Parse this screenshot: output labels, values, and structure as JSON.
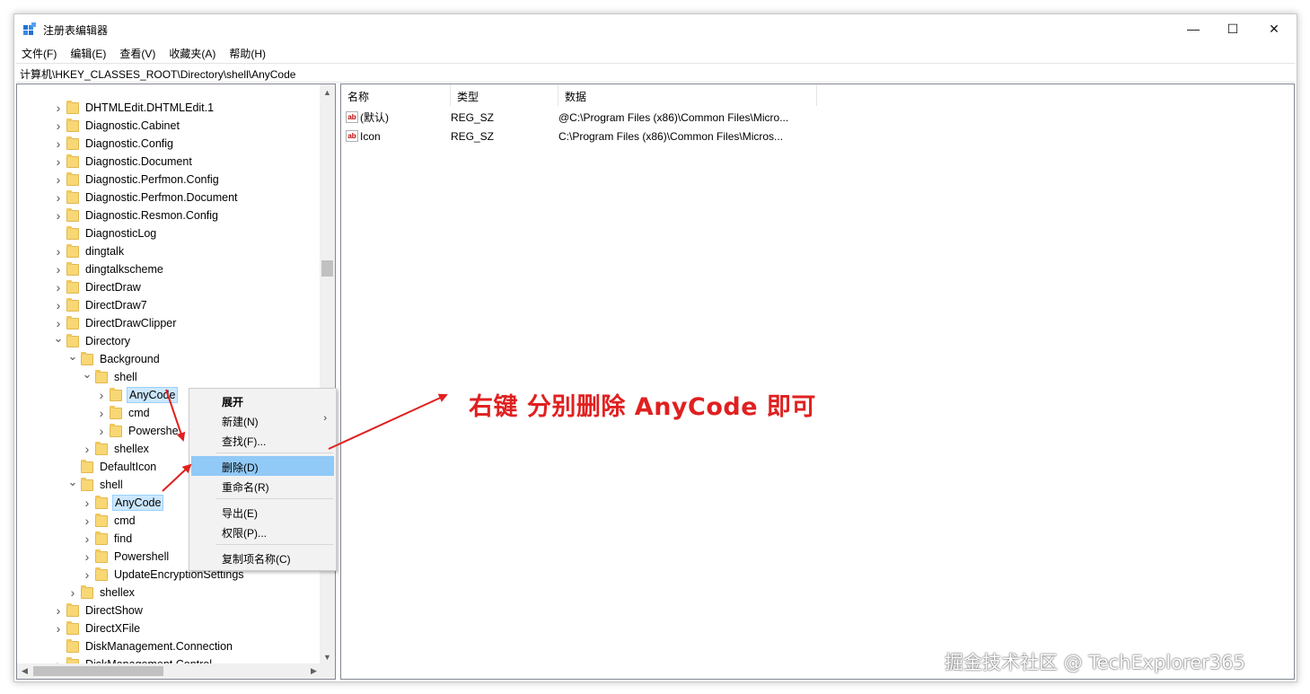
{
  "window": {
    "title": "注册表编辑器",
    "minimize": "—",
    "maximize": "☐",
    "close": "✕"
  },
  "menu": [
    "文件(F)",
    "编辑(E)",
    "查看(V)",
    "收藏夹(A)",
    "帮助(H)"
  ],
  "address": "计算机\\HKEY_CLASSES_ROOT\\Directory\\shell\\AnyCode",
  "tree": {
    "rows": [
      {
        "label": "DHTMLEdit.DHTMLEdit.1",
        "level": 0,
        "exp": "collapsed"
      },
      {
        "label": "Diagnostic.Cabinet",
        "level": 0,
        "exp": "collapsed"
      },
      {
        "label": "Diagnostic.Config",
        "level": 0,
        "exp": "collapsed"
      },
      {
        "label": "Diagnostic.Document",
        "level": 0,
        "exp": "collapsed"
      },
      {
        "label": "Diagnostic.Perfmon.Config",
        "level": 0,
        "exp": "collapsed"
      },
      {
        "label": "Diagnostic.Perfmon.Document",
        "level": 0,
        "exp": "collapsed"
      },
      {
        "label": "Diagnostic.Resmon.Config",
        "level": 0,
        "exp": "collapsed"
      },
      {
        "label": "DiagnosticLog",
        "level": 0,
        "exp": "none"
      },
      {
        "label": "dingtalk",
        "level": 0,
        "exp": "collapsed"
      },
      {
        "label": "dingtalkscheme",
        "level": 0,
        "exp": "collapsed"
      },
      {
        "label": "DirectDraw",
        "level": 0,
        "exp": "collapsed"
      },
      {
        "label": "DirectDraw7",
        "level": 0,
        "exp": "collapsed"
      },
      {
        "label": "DirectDrawClipper",
        "level": 0,
        "exp": "collapsed"
      },
      {
        "label": "Directory",
        "level": 0,
        "exp": "expanded"
      },
      {
        "label": "Background",
        "level": 1,
        "exp": "expanded"
      },
      {
        "label": "shell",
        "level": 2,
        "exp": "expanded"
      },
      {
        "label": "AnyCode",
        "level": 3,
        "exp": "collapsed",
        "selected": true
      },
      {
        "label": "cmd",
        "level": 3,
        "exp": "collapsed"
      },
      {
        "label": "Powershe",
        "level": 3,
        "exp": "collapsed"
      },
      {
        "label": "shellex",
        "level": 2,
        "exp": "collapsed"
      },
      {
        "label": "DefaultIcon",
        "level": 1,
        "exp": "none"
      },
      {
        "label": "shell",
        "level": 1,
        "exp": "expanded"
      },
      {
        "label": "AnyCode",
        "level": 2,
        "exp": "collapsed",
        "selected": true
      },
      {
        "label": "cmd",
        "level": 2,
        "exp": "collapsed"
      },
      {
        "label": "find",
        "level": 2,
        "exp": "collapsed"
      },
      {
        "label": "Powershell",
        "level": 2,
        "exp": "collapsed"
      },
      {
        "label": "UpdateEncryptionSettings",
        "level": 2,
        "exp": "collapsed"
      },
      {
        "label": "shellex",
        "level": 1,
        "exp": "collapsed"
      },
      {
        "label": "DirectShow",
        "level": 0,
        "exp": "collapsed"
      },
      {
        "label": "DirectXFile",
        "level": 0,
        "exp": "collapsed"
      },
      {
        "label": "DiskManagement.Connection",
        "level": 0,
        "exp": "none"
      },
      {
        "label": "DiskManagement.Control",
        "level": 0,
        "exp": "collapsed"
      }
    ]
  },
  "list": {
    "columns": [
      "名称",
      "类型",
      "数据"
    ],
    "rows": [
      {
        "name": "(默认)",
        "type": "REG_SZ",
        "data": "@C:\\Program Files (x86)\\Common Files\\Micro..."
      },
      {
        "name": "Icon",
        "type": "REG_SZ",
        "data": "C:\\Program Files (x86)\\Common Files\\Micros..."
      }
    ],
    "icon_text": "ab"
  },
  "context_menu": {
    "expand": "展开",
    "new": "新建(N)",
    "find": "查找(F)...",
    "delete": "删除(D)",
    "rename": "重命名(R)",
    "export": "导出(E)",
    "permissions": "权限(P)...",
    "copy_key_name": "复制项名称(C)",
    "submenu_arrow": "›"
  },
  "annotation": "右键 分别删除 AnyCode 即可",
  "watermark": "掘金技术社区 @ TechExplorer365",
  "colors": {
    "annotation": "#e02020",
    "selection": "#cce8ff",
    "menu_highlight": "#91c9f7",
    "folder": "#f8d775"
  }
}
